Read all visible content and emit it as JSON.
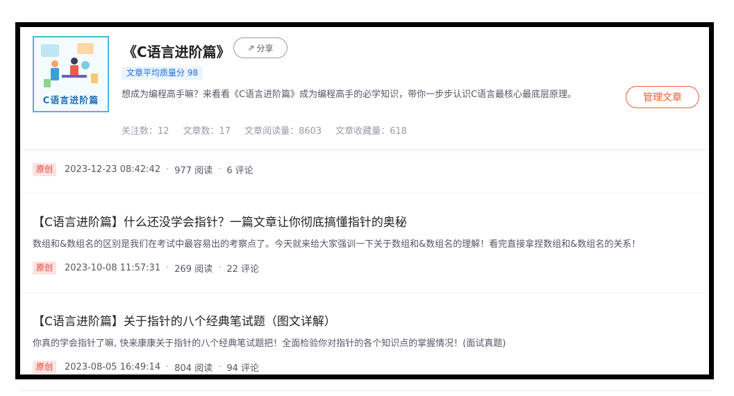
{
  "column": {
    "cover_text": "C语言进阶篇",
    "title": "《C语言进阶篇》",
    "share_label": "分享",
    "share_icon": "share-icon",
    "score_badge": "文章平均质量分 98",
    "description": "想成为编程高手嘛？来看看《C语言进阶篇》成为编程高手的必学知识，带你一步步认识C语言最核心最底层原理。",
    "stats": {
      "followers": "关注数：12",
      "articles": "文章数：17",
      "reads": "文章阅读量：8603",
      "favorites": "文章收藏量：618"
    },
    "manage_label": "管理文章"
  },
  "articles": [
    {
      "tag": "原创",
      "date": "2023-12-23 08:42:42",
      "reads": "977 阅读",
      "comments": "6 评论"
    },
    {
      "title": "【C语言进阶篇】什么还没学会指针？一篇文章让你彻底搞懂指针的奥秘",
      "desc": "数组和&数组名的区别是我们在考试中最容易出的考察点了。今天就来给大家强训一下关于数组和&数组名的理解！看完直接拿捏数组和&数组名的关系！",
      "tag": "原创",
      "date": "2023-10-08 11:57:31",
      "reads": "269 阅读",
      "comments": "22 评论"
    },
    {
      "title": "【C语言进阶篇】关于指针的八个经典笔试题（图文详解）",
      "desc": "你真的学会指针了嘛, 快来康康关于指针的八个经典笔试题把！全面检验你对指针的各个知识点的掌握情况！(面试真题)",
      "tag": "原创",
      "date": "2023-08-05 16:49:14",
      "reads": "804 阅读",
      "comments": "94 评论"
    }
  ],
  "colors": {
    "accent": "#fc5531",
    "badge_blue": "#1e6fd9",
    "tag_red": "#e33e33"
  }
}
